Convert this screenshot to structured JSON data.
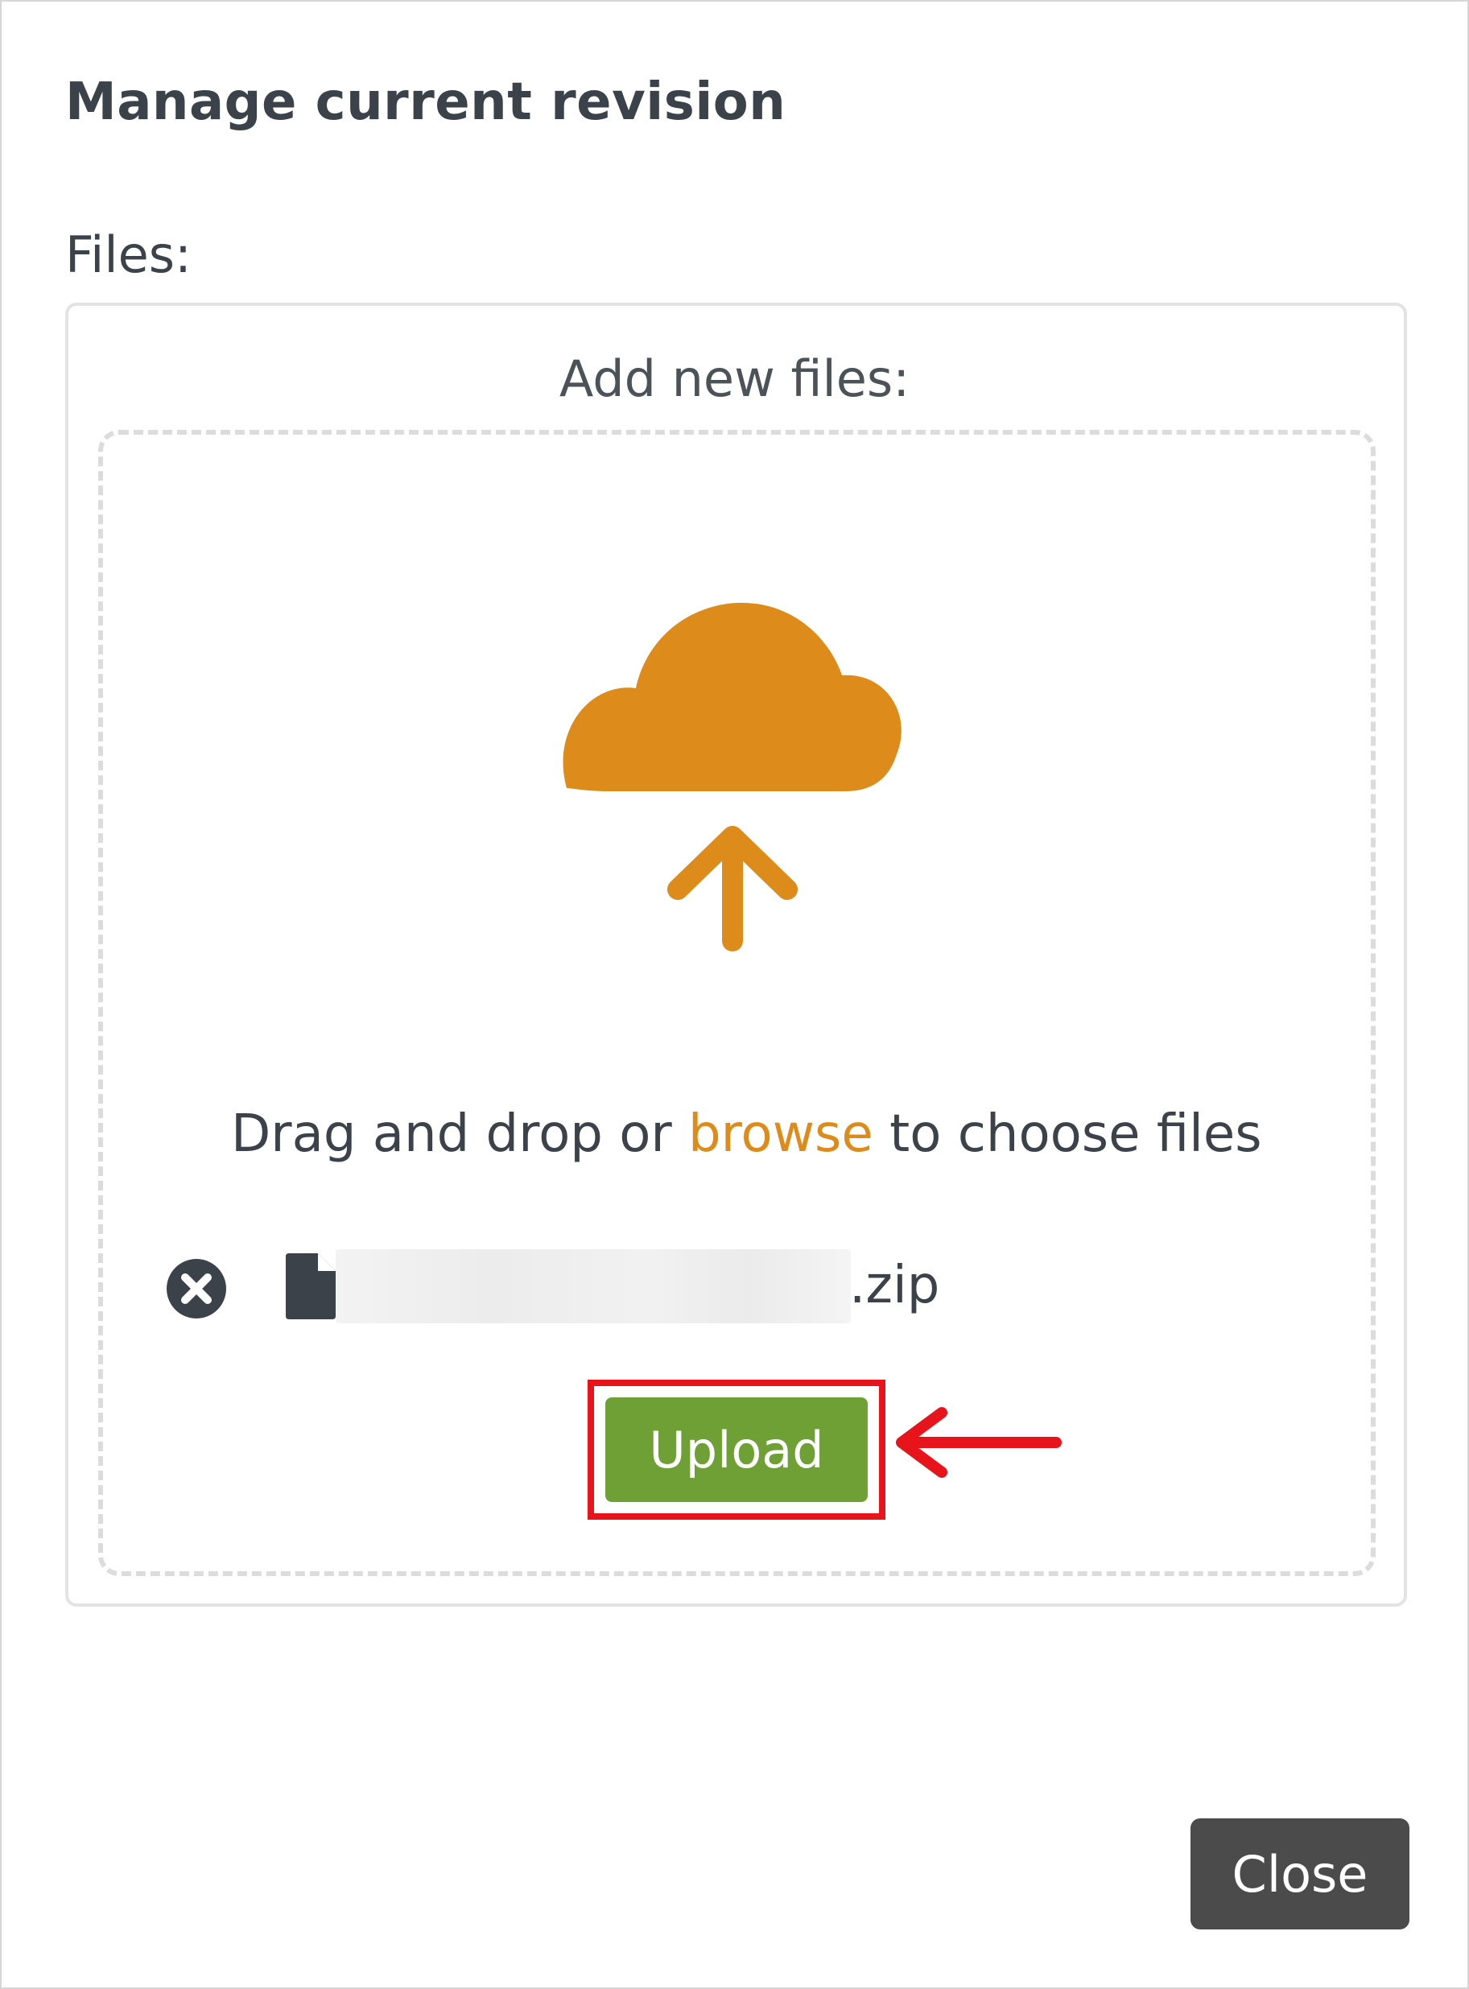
{
  "modal": {
    "title": "Manage current revision",
    "files_label": "Files:",
    "add_label": "Add new files:"
  },
  "dropzone": {
    "text_before": "Drag and drop or ",
    "browse_link": "browse",
    "text_after": " to choose files",
    "icon": "cloud-upload-icon",
    "icon_color": "#dd8b1a"
  },
  "file": {
    "name_visible_suffix": ".zip",
    "name_redacted": true,
    "remove_icon": "close-circle-icon",
    "type_icon": "file-icon"
  },
  "actions": {
    "upload_label": "Upload",
    "upload_color": "#6ea035",
    "close_label": "Close",
    "close_color": "#4b4b4b"
  },
  "annotation": {
    "highlight_color": "#e8141b",
    "target": "upload-button"
  }
}
